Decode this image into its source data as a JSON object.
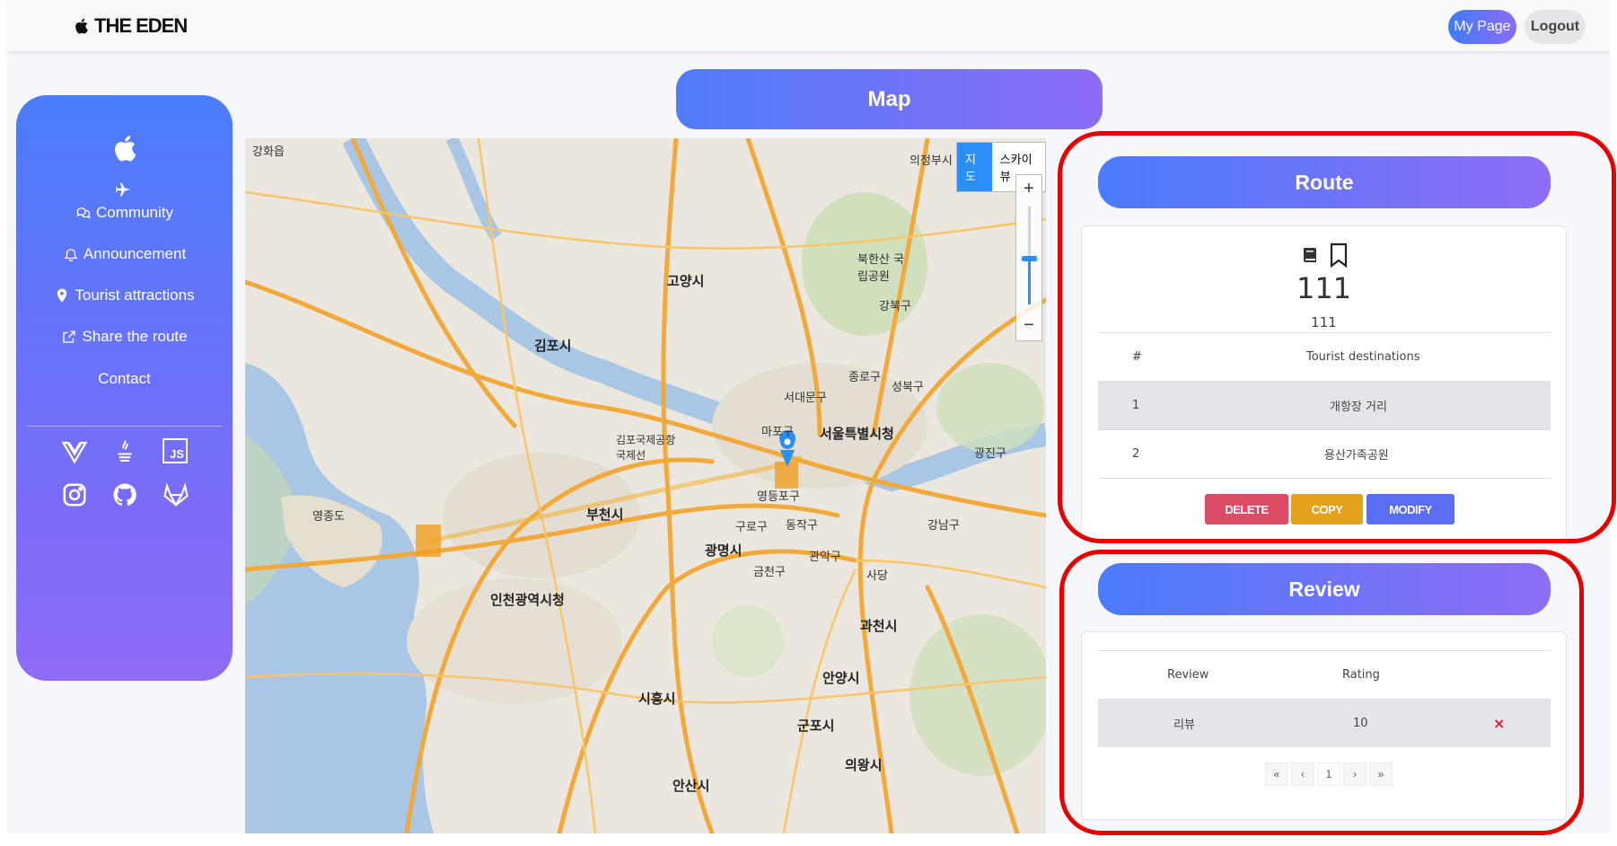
{
  "header": {
    "brand": "THE EDEN",
    "mypage_label": "My Page",
    "logout_label": "Logout"
  },
  "sidebar": {
    "items": [
      {
        "label": "Community",
        "icon": "chat-icon"
      },
      {
        "label": "Announcement",
        "icon": "bell-icon"
      },
      {
        "label": "Tourist attractions",
        "icon": "pin-icon"
      },
      {
        "label": "Share the route",
        "icon": "share-icon"
      },
      {
        "label": "Contact",
        "icon": ""
      }
    ],
    "tech_icons": [
      "vue-icon",
      "java-icon",
      "js-icon",
      "instagram-icon",
      "github-icon",
      "gitlab-icon"
    ],
    "js_text": "JS"
  },
  "map": {
    "title": "Map",
    "maptype_map": "지도",
    "maptype_sky": "스카이뷰",
    "zoom_in": "+",
    "zoom_out": "−",
    "labels": {
      "seoul_cityhall": "서울특별시청",
      "incheon_cityhall": "인천광역시청",
      "gimpo": "김포시",
      "goyang": "고양시",
      "bucheon": "부천시",
      "gwangmyeong": "광명시",
      "gwacheon": "과천시",
      "anyang": "안양시",
      "siheung": "시흥시",
      "gunpo": "군포시",
      "uiwang": "의왕시",
      "ansan": "안산시",
      "uijeongbu": "의정부시",
      "gangwha": "강화읍",
      "yeongjongdo": "영종도",
      "mapo": "마포구",
      "seodaemun": "서대문구",
      "yeongdeungpo": "영등포구",
      "gangnam": "강남구",
      "gimpo_airport": "김포국제공항 국제선",
      "bukhansan": "북한산 국립공원",
      "gangbuk": "강북구",
      "jongno": "종로구",
      "seongbuk": "성북구",
      "dongjak": "동작구",
      "gwanak": "관악구",
      "guro": "구로구",
      "geumcheon": "금천구",
      "gwangjin": "광진구",
      "sadang": "사당"
    }
  },
  "route": {
    "header": "Route",
    "title": "111",
    "subtitle": "111",
    "col_num": "#",
    "col_dest": "Tourist destinations",
    "rows": [
      {
        "num": "1",
        "name": "개항장 거리"
      },
      {
        "num": "2",
        "name": "용산가족공원"
      }
    ],
    "delete_label": "DELETE",
    "copy_label": "COPY",
    "modify_label": "MODIFY"
  },
  "review": {
    "header": "Review",
    "col_review": "Review",
    "col_rating": "Rating",
    "rows": [
      {
        "review": "리뷰",
        "rating": "10",
        "remove": "×"
      }
    ],
    "pager": {
      "first": "«",
      "prev": "‹",
      "page": "1",
      "next": "›",
      "last": "»"
    }
  },
  "colors": {
    "accent_start": "#4a7bfa",
    "accent_end": "#8f6df6",
    "delete": "#dc4c64",
    "copy": "#e4a11b",
    "modify": "#5a6ef3",
    "annotation": "#e60000"
  }
}
